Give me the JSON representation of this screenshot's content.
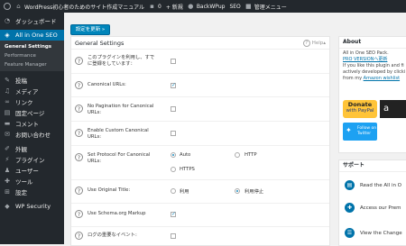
{
  "adminbar": {
    "site_title": "WordPress初心者のためのサイト作成マニュアル",
    "comments_count": "0",
    "new_label": "+ 新規",
    "backwpup_label": "BackWPup",
    "seo_label": "SEO",
    "admin_menu_label": "管理メニュー"
  },
  "sidebar": {
    "items": [
      {
        "label": "ダッシュボード",
        "icon": "dashboard-icon"
      },
      {
        "label": "All in One SEO",
        "icon": "aioseo-icon"
      }
    ],
    "submenu": [
      "General Settings",
      "Performance",
      "Feature Manager"
    ],
    "items2": [
      {
        "label": "投稿",
        "icon": "pin-icon"
      },
      {
        "label": "メディア",
        "icon": "media-icon"
      },
      {
        "label": "リンク",
        "icon": "link-icon"
      },
      {
        "label": "固定ページ",
        "icon": "page-icon"
      },
      {
        "label": "コメント",
        "icon": "comment-icon"
      },
      {
        "label": "お問い合わせ",
        "icon": "mail-icon"
      }
    ],
    "items3": [
      {
        "label": "外観",
        "icon": "brush-icon"
      },
      {
        "label": "プラグイン",
        "icon": "plugin-icon"
      },
      {
        "label": "ユーザー",
        "icon": "user-icon"
      },
      {
        "label": "ツール",
        "icon": "wrench-icon"
      },
      {
        "label": "設定",
        "icon": "settings-icon"
      }
    ],
    "items4": [
      {
        "label": "WP Security",
        "icon": "shield-icon"
      }
    ]
  },
  "save_button": "設定を更新 »",
  "panel": {
    "title": "General Settings",
    "help": "Help",
    "rows": [
      {
        "label": "このプラグインを利用し、すでに登録をしています：",
        "checked": false
      },
      {
        "label": "Canonical URLs:",
        "checked": true
      },
      {
        "label": "No Pagination for Canonical URLs:",
        "checked": false
      },
      {
        "label": "Enable Custom Canonical URLs:",
        "checked": false
      },
      {
        "label": "Set Protocol For Canonical URLs:",
        "options": [
          "Auto",
          "HTTP",
          "HTTPS"
        ],
        "selected": "Auto"
      },
      {
        "label": "Use Original Title:",
        "options": [
          "利用",
          "利用停止"
        ],
        "selected": "利用停止"
      },
      {
        "label": "Use Schema.org Markup",
        "checked": true
      },
      {
        "label": "ログの重要なイベント:",
        "checked": false
      }
    ]
  },
  "about": {
    "title": "About",
    "line1": "All in One SEO Pack.",
    "pro_link": "PRO VERSIONへ更新",
    "line2": "If you like this plugin and fi",
    "line3": "actively developed by clicki",
    "line4_prefix": "from my ",
    "amazon_link": "Amazon wishlist",
    "donate_title": "Donate",
    "donate_sub": "with PayPal",
    "amazon_letter": "a",
    "twitter_line1": "Follow on",
    "twitter_line2": "Twitter"
  },
  "support": {
    "title": "サポート",
    "items": [
      {
        "label": "Read the All in O",
        "icon": "book-icon"
      },
      {
        "label": "Access our Prem",
        "icon": "support-icon"
      },
      {
        "label": "View the Change",
        "icon": "changelog-icon"
      }
    ]
  },
  "colors": {
    "admin_dark": "#23282d",
    "accent_blue": "#0073aa",
    "button_blue": "#0085ba",
    "paypal_yellow": "#ffc439",
    "twitter_blue": "#1da1f2"
  }
}
